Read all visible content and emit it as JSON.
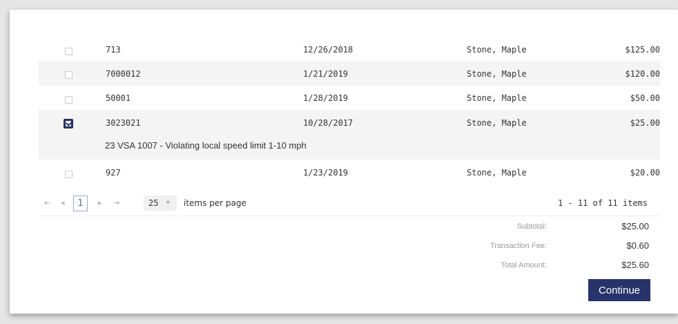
{
  "rows": [
    {
      "id": "713",
      "date": "12/26/2018",
      "name": "Stone, Maple",
      "amount": "$125.00",
      "checked": false
    },
    {
      "id": "7000012",
      "date": "1/21/2019",
      "name": "Stone, Maple",
      "amount": "$120.00",
      "checked": false
    },
    {
      "id": "50001",
      "date": "1/28/2019",
      "name": "Stone, Maple",
      "amount": "$50.00",
      "checked": false
    },
    {
      "id": "3023021",
      "date": "10/28/2017",
      "name": "Stone, Maple",
      "amount": "$25.00",
      "checked": true,
      "description": "23 VSA 1007 - Violating local speed limit 1-10 mph"
    },
    {
      "id": "927",
      "date": "1/23/2019",
      "name": "Stone, Maple",
      "amount": "$20.00",
      "checked": false
    }
  ],
  "pager": {
    "first": "⇤",
    "prev": "◂",
    "current_page": "1",
    "next": "▸",
    "last": "⇥",
    "page_size": "25",
    "items_per_page_label": "items per page",
    "info": "1 - 11 of 11 items"
  },
  "summary": {
    "subtotal_label": "Subtotal:",
    "subtotal_value": "$25.00",
    "fee_label": "Transaction Fee:",
    "fee_value": "$0.60",
    "total_label": "Total Amount:",
    "total_value": "$25.60"
  },
  "continue_label": "Continue",
  "colors": {
    "primary": "#283369",
    "row_alt": "#f4f4f4",
    "background": "#e6e6e6"
  }
}
